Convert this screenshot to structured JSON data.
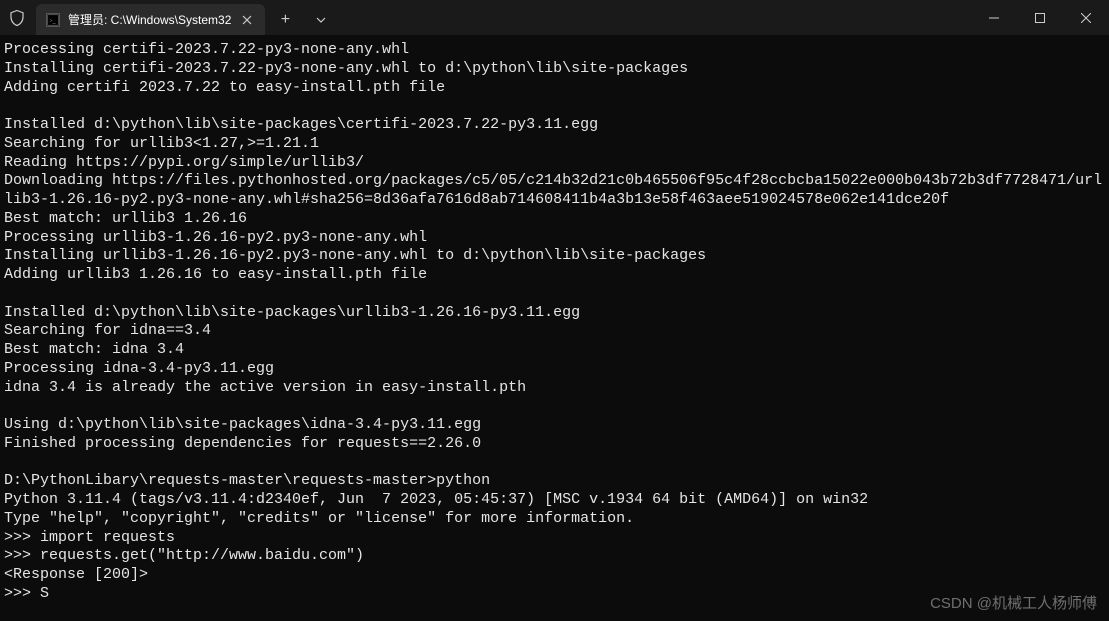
{
  "titlebar": {
    "tab_title": "管理员: C:\\Windows\\System32",
    "new_tab_symbol": "+",
    "dropdown_symbol": "∨",
    "minimize_symbol": "―",
    "maximize_symbol": "▢",
    "close_symbol": "✕"
  },
  "terminal": {
    "lines": [
      "Processing certifi-2023.7.22-py3-none-any.whl",
      "Installing certifi-2023.7.22-py3-none-any.whl to d:\\python\\lib\\site-packages",
      "Adding certifi 2023.7.22 to easy-install.pth file",
      "",
      "Installed d:\\python\\lib\\site-packages\\certifi-2023.7.22-py3.11.egg",
      "Searching for urllib3<1.27,>=1.21.1",
      "Reading https://pypi.org/simple/urllib3/",
      "Downloading https://files.pythonhosted.org/packages/c5/05/c214b32d21c0b465506f95c4f28ccbcba15022e000b043b72b3df7728471/urllib3-1.26.16-py2.py3-none-any.whl#sha256=8d36afa7616d8ab714608411b4a3b13e58f463aee519024578e062e141dce20f",
      "Best match: urllib3 1.26.16",
      "Processing urllib3-1.26.16-py2.py3-none-any.whl",
      "Installing urllib3-1.26.16-py2.py3-none-any.whl to d:\\python\\lib\\site-packages",
      "Adding urllib3 1.26.16 to easy-install.pth file",
      "",
      "Installed d:\\python\\lib\\site-packages\\urllib3-1.26.16-py3.11.egg",
      "Searching for idna==3.4",
      "Best match: idna 3.4",
      "Processing idna-3.4-py3.11.egg",
      "idna 3.4 is already the active version in easy-install.pth",
      "",
      "Using d:\\python\\lib\\site-packages\\idna-3.4-py3.11.egg",
      "Finished processing dependencies for requests==2.26.0",
      "",
      "D:\\PythonLibary\\requests-master\\requests-master>python",
      "Python 3.11.4 (tags/v3.11.4:d2340ef, Jun  7 2023, 05:45:37) [MSC v.1934 64 bit (AMD64)] on win32",
      "Type \"help\", \"copyright\", \"credits\" or \"license\" for more information.",
      ">>> import requests",
      ">>> requests.get(\"http://www.baidu.com\")",
      "<Response [200]>",
      ">>> S"
    ]
  },
  "watermark": "CSDN @机械工人杨师傅"
}
